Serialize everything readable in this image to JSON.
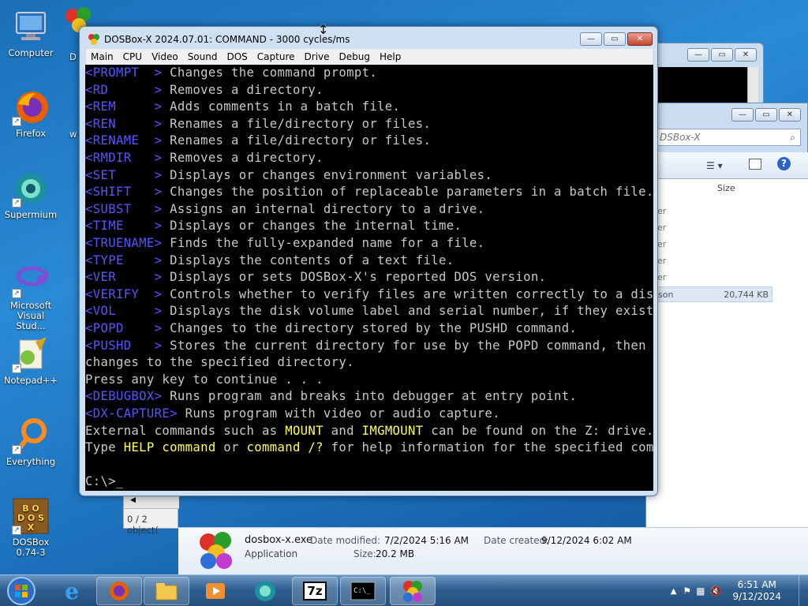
{
  "desktop": {
    "icons": [
      {
        "label": "Computer",
        "icon": "computer-icon"
      },
      {
        "label": "Firefox",
        "icon": "firefox-icon"
      },
      {
        "label": "Supermium",
        "icon": "supermium-icon"
      },
      {
        "label": "Microsoft Visual Stud...",
        "icon": "visual-studio-icon"
      },
      {
        "label": "Notepad++",
        "icon": "notepadpp-icon"
      },
      {
        "label": "Everything",
        "icon": "everything-icon"
      },
      {
        "label": "DOSBox 0.74-3",
        "icon": "dosbox-icon"
      }
    ],
    "partial_labels": [
      "D",
      "w"
    ]
  },
  "dosbox": {
    "title": "DOSBox-X 2024.07.01: COMMAND - 3000 cycles/ms",
    "menu": [
      "Main",
      "CPU",
      "Video",
      "Sound",
      "DOS",
      "Capture",
      "Drive",
      "Debug",
      "Help"
    ],
    "lines": [
      {
        "cmd": "<PROMPT  >",
        "text": " Changes the command prompt."
      },
      {
        "cmd": "<RD      >",
        "text": " Removes a directory."
      },
      {
        "cmd": "<REM     >",
        "text": " Adds comments in a batch file."
      },
      {
        "cmd": "<REN     >",
        "text": " Renames a file/directory or files."
      },
      {
        "cmd": "<RENAME  >",
        "text": " Renames a file/directory or files."
      },
      {
        "cmd": "<RMDIR   >",
        "text": " Removes a directory."
      },
      {
        "cmd": "<SET     >",
        "text": " Displays or changes environment variables."
      },
      {
        "cmd": "<SHIFT   >",
        "text": " Changes the position of replaceable parameters in a batch file."
      },
      {
        "cmd": "<SUBST   >",
        "text": " Assigns an internal directory to a drive."
      },
      {
        "cmd": "<TIME    >",
        "text": " Displays or changes the internal time."
      },
      {
        "cmd": "<TRUENAME>",
        "text": " Finds the fully-expanded name for a file."
      },
      {
        "cmd": "<TYPE    >",
        "text": " Displays the contents of a text file."
      },
      {
        "cmd": "<VER     >",
        "text": " Displays or sets DOSBox-X's reported DOS version."
      },
      {
        "cmd": "<VERIFY  >",
        "text": " Controls whether to verify files are written correctly to a disk."
      },
      {
        "cmd": "<VOL     >",
        "text": " Displays the disk volume label and serial number, if they exist."
      },
      {
        "cmd": "<POPD    >",
        "text": " Changes to the directory stored by the PUSHD command."
      },
      {
        "cmd": "<PUSHD   >",
        "text": " Stores the current directory for use by the POPD command, then"
      },
      {
        "cmd": "",
        "text": "changes to the specified directory."
      },
      {
        "cmd": "",
        "text": "Press any key to continue . . ."
      },
      {
        "cmd": "<DEBUGBOX>",
        "text": " Runs program and breaks into debugger at entry point."
      },
      {
        "cmd": "<DX-CAPTURE>",
        "text": " Runs program with video or audio capture."
      }
    ],
    "external_line": {
      "a": "External commands such as ",
      "b": "MOUNT",
      "c": " and ",
      "d": "IMGMOUNT",
      "e": " can be found on the Z: drive."
    },
    "help_line": {
      "a": "Type ",
      "b": "HELP command",
      "c": " or ",
      "d": "command /?",
      "e": " for help information for the specified command."
    },
    "prompt": "C:\\>_"
  },
  "explorer": {
    "address": "DSBox-X",
    "size_header": "Size",
    "row_partials": [
      "er",
      "er",
      "er",
      "er",
      "er"
    ],
    "selected_row_partial": "son",
    "selected_size": "20,744 KB",
    "status": "0 / 2 object(",
    "details": {
      "filename": "dosbox-x.exe",
      "type": "Application",
      "modified_label": "Date modified:",
      "modified": "7/2/2024 5:16 AM",
      "created_label": "Date created:",
      "created": "9/12/2024 6:02 AM",
      "size_label": "Size:",
      "size": "20.2 MB"
    }
  },
  "taskbar": {
    "buttons": [
      "start-button",
      "internet-explorer-icon",
      "firefox-icon",
      "explorer-icon",
      "media-player-icon",
      "supermium-icon",
      "7zip-icon",
      "cmd-icon",
      "dosbox-x-icon"
    ],
    "time": "6:51 AM",
    "date": "9/12/2024"
  }
}
